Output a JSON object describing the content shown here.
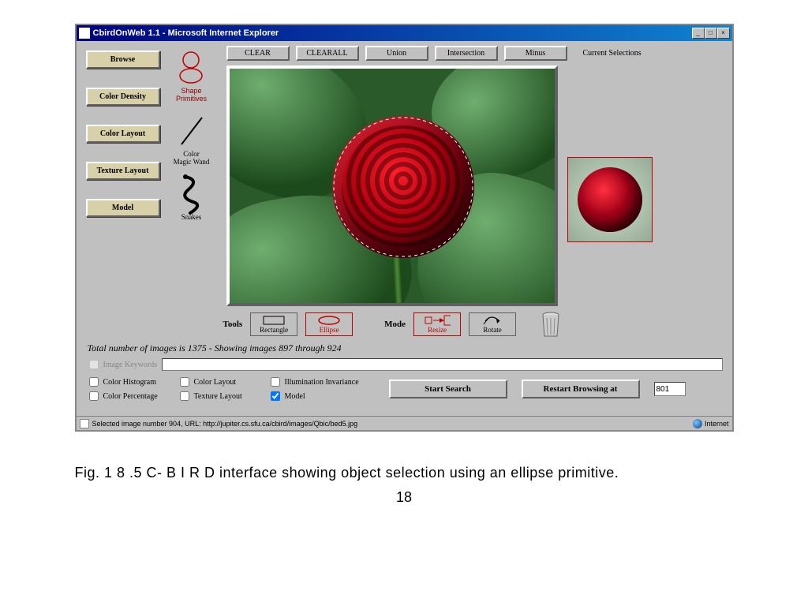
{
  "window": {
    "title": "CbirdOnWeb 1.1 - Microsoft Internet Explorer",
    "minimize": "_",
    "maximize": "□",
    "close": "×"
  },
  "sidebar": {
    "browse": "Browse",
    "color_density": "Color Density",
    "color_layout": "Color Layout",
    "texture_layout": "Texture Layout",
    "model": "Model"
  },
  "tools": {
    "shape_primitives": "Shape\nPrimitives",
    "color_magic_wand": "Color\nMagic Wand",
    "snakes": "Snakes"
  },
  "topbar": {
    "clear": "CLEAR",
    "clearall": "CLEARALL",
    "union": "Union",
    "intersection": "Intersection",
    "minus": "Minus",
    "current_selections": "Current Selections"
  },
  "tools_row": {
    "tools_label": "Tools",
    "rectangle": "Rectangle",
    "ellipse": "Ellipse",
    "mode_label": "Mode",
    "resize": "Resize",
    "rotate": "Rotate"
  },
  "status_text": "Total number of images is 1375  -  Showing images 897 through 924",
  "keywords": {
    "label": "Image Keywords"
  },
  "checks": {
    "color_histogram": "Color Histogram",
    "color_layout": "Color Layout",
    "illumination_invariance": "Illumination Invariance",
    "color_percentage": "Color Percentage",
    "texture_layout": "Texture Layout",
    "model": "Model"
  },
  "actions": {
    "start_search": "Start Search",
    "restart_browsing": "Restart Browsing at",
    "restart_value": "801"
  },
  "statusbar": {
    "text": "Selected image number 904, URL: http://jupiter.cs.sfu.ca/cbird/images/Qbic/bed5.jpg",
    "zone": "Internet"
  },
  "caption": "Fig.  1 8 .5 C- B I R D interface showing object selection using   an ellipse primitive.",
  "pagenum": "18"
}
